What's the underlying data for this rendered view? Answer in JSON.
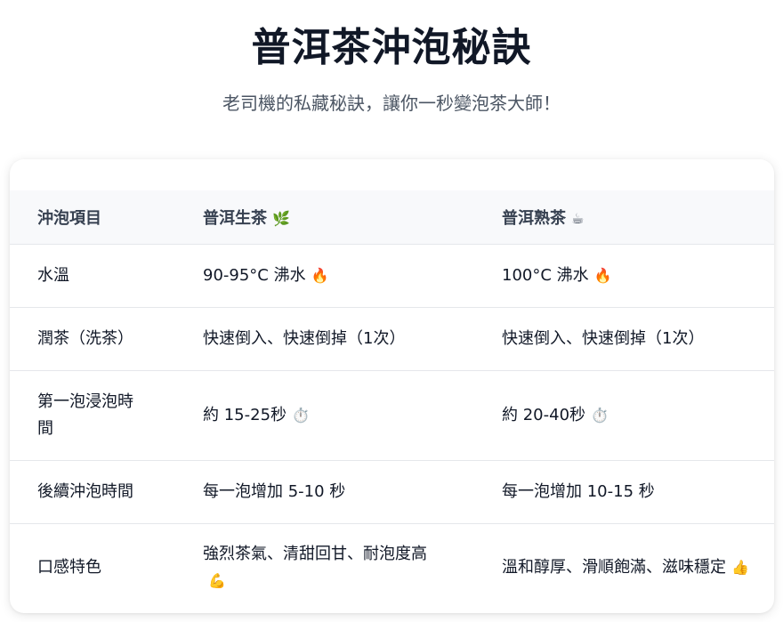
{
  "header": {
    "title": "普洱茶沖泡秘訣",
    "subtitle": "老司機的私藏秘訣，讓你一秒變泡茶大師！"
  },
  "table": {
    "columns": [
      {
        "label": "沖泡項目",
        "emoji": ""
      },
      {
        "label": "普洱生茶",
        "emoji": "🌿"
      },
      {
        "label": "普洱熟茶",
        "emoji": "☕"
      }
    ],
    "rows": [
      {
        "item": "水溫",
        "raw": {
          "text": "90-95°C 沸水",
          "emoji": "🔥"
        },
        "ripe": {
          "text": "100°C 沸水",
          "emoji": "🔥"
        }
      },
      {
        "item": "潤茶（洗茶）",
        "raw": {
          "text": "快速倒入、快速倒掉（1次）",
          "emoji": ""
        },
        "ripe": {
          "text": "快速倒入、快速倒掉（1次）",
          "emoji": ""
        }
      },
      {
        "item": "第一泡浸泡時間",
        "raw": {
          "text": "約 15-25秒",
          "emoji": "⏱️"
        },
        "ripe": {
          "text": "約 20-40秒",
          "emoji": "⏱️"
        }
      },
      {
        "item": "後續沖泡時間",
        "raw": {
          "text": "每一泡增加 5-10 秒",
          "emoji": ""
        },
        "ripe": {
          "text": "每一泡增加 10-15 秒",
          "emoji": ""
        }
      },
      {
        "item": "口感特色",
        "raw": {
          "text": "強烈茶氣、清甜回甘、耐泡度高",
          "emoji": "💪"
        },
        "ripe": {
          "text": "溫和醇厚、滑順飽滿、滋味穩定",
          "emoji": "👍"
        }
      }
    ]
  }
}
